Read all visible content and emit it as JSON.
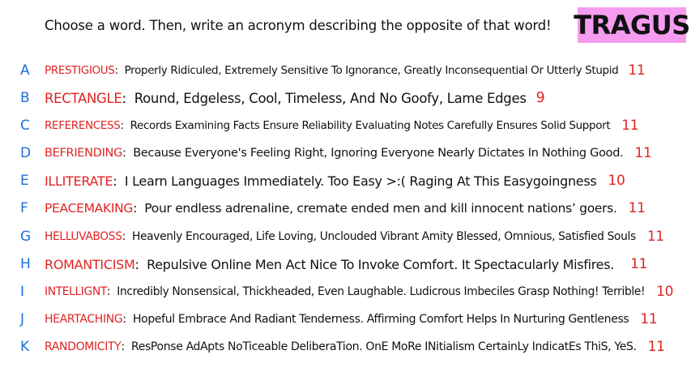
{
  "instructions": "Choose a word. Then, write an acronym describing the opposite of that word!",
  "logo": "TRAGUS",
  "colors": {
    "letter": "#1e6fd9",
    "word": "#e02424",
    "text": "#111111",
    "logo_bg": "#f59cf0"
  },
  "rows": [
    {
      "letter": "A",
      "word": "PRESTIGIOUS",
      "acronym": "Properly Ridiculed, Extremely Sensitive To Ignorance, Greatly Inconsequential Or Utterly Stupid",
      "count": "11"
    },
    {
      "letter": "B",
      "word": "RECTANGLE",
      "acronym": "Round, Edgeless, Cool, Timeless, And No Goofy, Lame Edges",
      "count": "9"
    },
    {
      "letter": "C",
      "word": "REFERENCESS",
      "acronym": "Records Examining Facts Ensure Reliability Evaluating Notes Carefully Ensures Solid Support",
      "count": "11"
    },
    {
      "letter": "D",
      "word": "BEFRIENDING",
      "acronym": "Because Everyone's Feeling Right, Ignoring Everyone Nearly Dictates In Nothing Good.",
      "count": "11"
    },
    {
      "letter": "E",
      "word": "ILLITERATE",
      "acronym": "I Learn Languages Immediately. Too Easy >:( Raging At This Easygoingness",
      "count": "10"
    },
    {
      "letter": "F",
      "word": "PEACEMAKING",
      "acronym": "Pour endless adrenaline, cremate ended men and kill innocent nations’ goers.",
      "count": "11"
    },
    {
      "letter": "G",
      "word": "HELLUVABOSS",
      "acronym": "Heavenly Encouraged, Life Loving, Unclouded Vibrant Amity Blessed, Omnious, Satisfied Souls",
      "count": "11"
    },
    {
      "letter": "H",
      "word": "ROMANTICISM",
      "acronym": "Repulsive Online Men Act Nice To Invoke Comfort. It Spectacularly Misfires.",
      "count": "11"
    },
    {
      "letter": "I",
      "word": "INTELLIGNT",
      "acronym": "Incredibly Nonsensical, Thickheaded, Even Laughable. Ludicrous Imbeciles Grasp Nothing! Terrible!",
      "count": "10"
    },
    {
      "letter": "J",
      "word": "HEARTACHING",
      "acronym": "Hopeful Embrace And Radiant Tenderness. Affirming Comfort Helps In Nurturing Gentleness",
      "count": "11"
    },
    {
      "letter": "K",
      "word": "RANDOMICITY",
      "acronym": "ResPonse AdApts NoTiceable DeliberaTion. OnE MoRe INitialism CertainLy IndicatEs ThiS, YeS.",
      "count": "11"
    }
  ]
}
